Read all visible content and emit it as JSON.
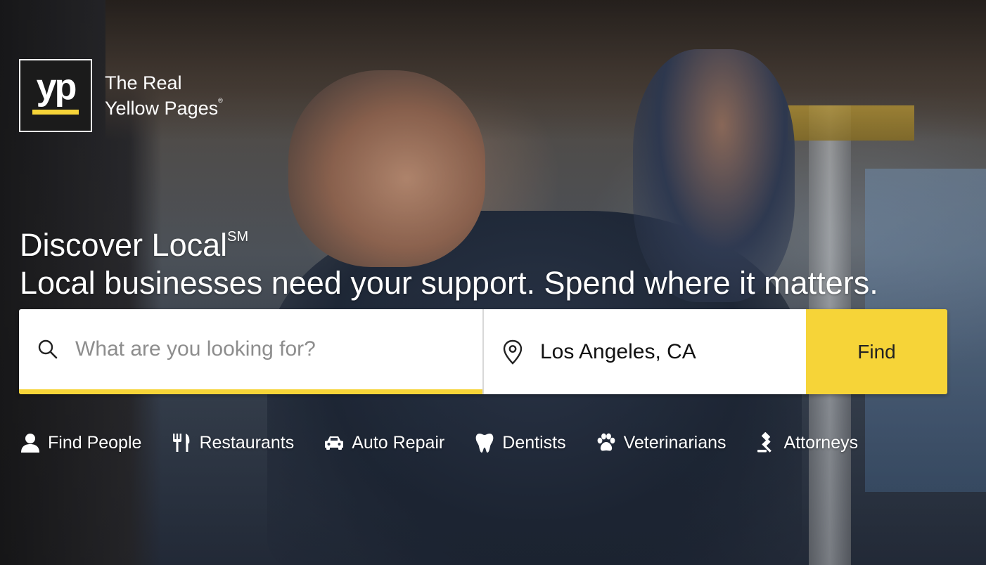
{
  "brand": {
    "mark": "yp",
    "name_line1": "The Real",
    "name_line2": "Yellow Pages",
    "trademark": "®",
    "accent_color": "#f6d438"
  },
  "hero": {
    "title": "Discover Local",
    "title_mark": "SM",
    "subtitle": "Local businesses need your support. Spend where it matters."
  },
  "search": {
    "what_placeholder": "What are you looking for?",
    "what_value": "",
    "where_value": "Los Angeles, CA",
    "find_label": "Find",
    "what_icon": "search-icon",
    "where_icon": "location-pin-icon"
  },
  "categories": [
    {
      "label": "Find People",
      "icon": "person-icon"
    },
    {
      "label": "Restaurants",
      "icon": "fork-knife-icon"
    },
    {
      "label": "Auto Repair",
      "icon": "car-icon"
    },
    {
      "label": "Dentists",
      "icon": "tooth-icon"
    },
    {
      "label": "Veterinarians",
      "icon": "paw-icon"
    },
    {
      "label": "Attorneys",
      "icon": "gavel-icon"
    }
  ]
}
